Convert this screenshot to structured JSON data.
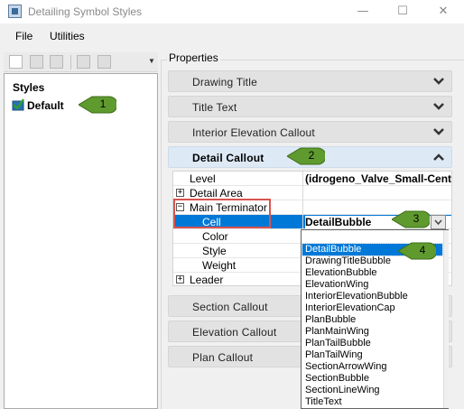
{
  "window": {
    "title": "Detailing Symbol Styles",
    "icon": "app-window-icon"
  },
  "menu": {
    "file": "File",
    "utilities": "Utilities"
  },
  "toolbar": {
    "icons": [
      "new-icon",
      "save-icon",
      "copy-icon",
      "rename-icon",
      "import-icon",
      "toolbar-overflow-icon"
    ]
  },
  "styles_pane": {
    "heading": "Styles",
    "items": [
      {
        "label": "Default",
        "icon": "checked-style-icon"
      }
    ]
  },
  "properties": {
    "legend": "Properties",
    "sections_top": [
      {
        "label": "Drawing Title",
        "state": "collapsed"
      },
      {
        "label": "Title Text",
        "state": "collapsed"
      },
      {
        "label": "Interior Elevation Callout",
        "state": "collapsed"
      }
    ],
    "expanded_section": {
      "label": "Detail Callout",
      "state": "expanded"
    },
    "grid": {
      "level": {
        "name": "Level",
        "value": "(idrogeno_Valve_Small-Cent"
      },
      "detail_area": {
        "name": "Detail Area"
      },
      "main_terminator": {
        "name": "Main Terminator"
      },
      "cell": {
        "name": "Cell",
        "value": "DetailBubble"
      },
      "color": {
        "name": "Color"
      },
      "style": {
        "name": "Style"
      },
      "weight": {
        "name": "Weight"
      },
      "leader": {
        "name": "Leader"
      }
    },
    "sections_bottom": [
      {
        "label": "Section Callout",
        "state": "collapsed"
      },
      {
        "label": "Elevation Callout",
        "state": "collapsed"
      },
      {
        "label": "Plan Callout",
        "state": "collapsed"
      }
    ]
  },
  "cell_dropdown": {
    "selected": "DetailBubble",
    "options": [
      "DetailBubble",
      "DrawingTitleBubble",
      "ElevationBubble",
      "ElevationWing",
      "InteriorElevationBubble",
      "InteriorElevationCap",
      "PlanBubble",
      "PlanMainWing",
      "PlanTailBubble",
      "PlanTailWing",
      "SectionArrowWing",
      "SectionBubble",
      "SectionLineWing",
      "TitleText"
    ]
  },
  "callouts": [
    "1",
    "2",
    "3",
    "4"
  ],
  "colors": {
    "accent": "#0078d7",
    "highlight_box": "#d9534f",
    "callout_green": "#5f9a2f"
  }
}
